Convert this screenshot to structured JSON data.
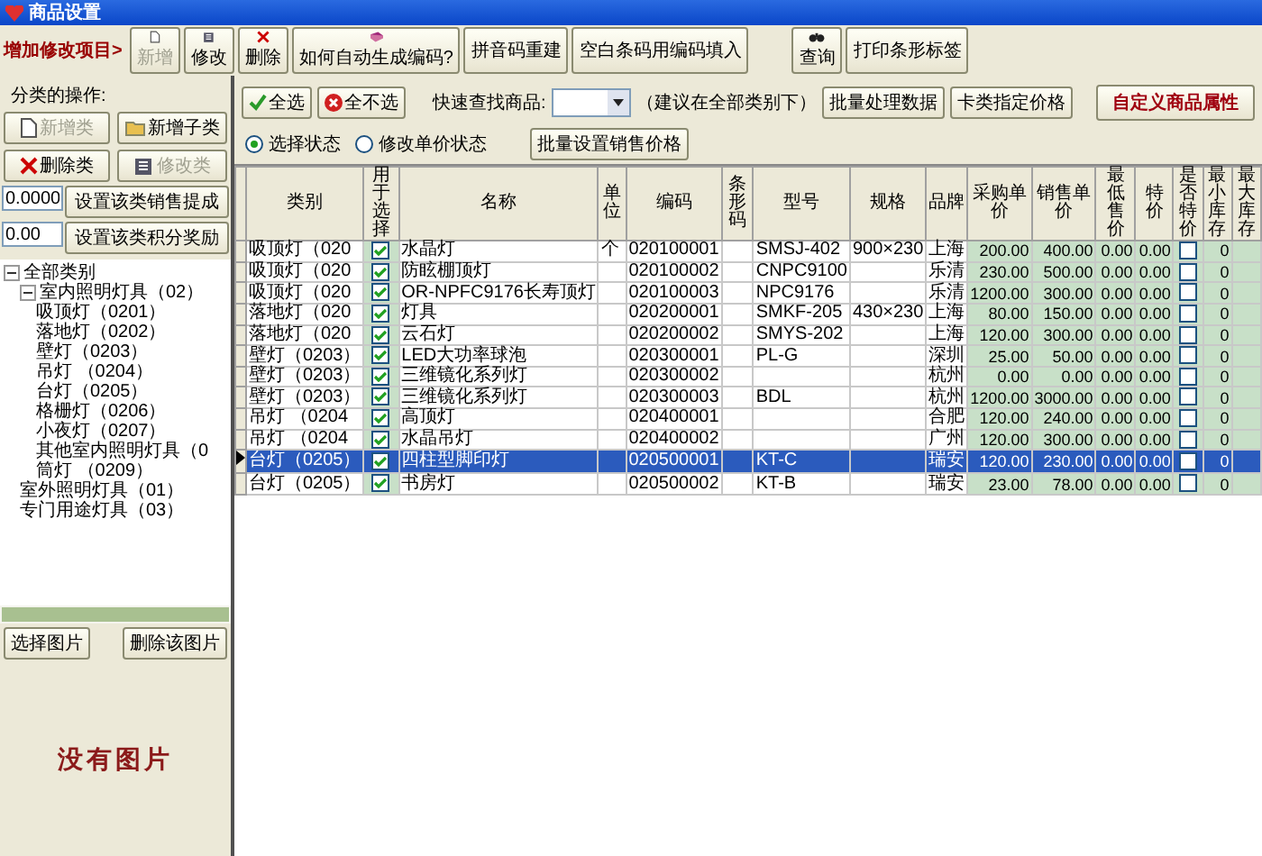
{
  "window": {
    "title": "商品设置"
  },
  "toolbar": {
    "label": "增加修改项目>",
    "buttons": [
      {
        "label": "新增",
        "kind": "page",
        "disabled": true
      },
      {
        "label": "修改",
        "kind": "edit",
        "disabled": false
      },
      {
        "label": "删除",
        "kind": "cross",
        "disabled": false
      },
      {
        "label": "如何自动生成编码?",
        "kind": "book",
        "disabled": false
      },
      {
        "label": "拼音码重建",
        "disabled": false
      },
      {
        "label": "空白条码用编码填入",
        "disabled": false
      }
    ],
    "right_buttons": [
      {
        "label": "查询",
        "kind": "binoculars",
        "disabled": false
      },
      {
        "label": "打印条形标签",
        "disabled": false
      }
    ]
  },
  "category_ops": {
    "label": "分类的操作:",
    "buttons": [
      {
        "label": "新增类",
        "kind": "page",
        "disabled": true
      },
      {
        "label": "新增子类",
        "kind": "folder",
        "disabled": false
      },
      {
        "label": "删除类",
        "kind": "cross",
        "disabled": false
      },
      {
        "label": "修改类",
        "kind": "edit",
        "disabled": true
      }
    ],
    "settings": [
      {
        "value": "0.0000",
        "button": "设置该类销售提成"
      },
      {
        "value": "0.00",
        "button": "设置该类积分奖励"
      }
    ]
  },
  "tree": {
    "label": "全部类别",
    "expanded": true,
    "children": [
      {
        "label": "室内照明灯具（02）",
        "expanded": true,
        "children": [
          {
            "label": "吸顶灯（0201）"
          },
          {
            "label": "落地灯（0202）"
          },
          {
            "label": "壁灯（0203）"
          },
          {
            "label": "吊灯 （0204）"
          },
          {
            "label": "台灯（0205）"
          },
          {
            "label": "格栅灯（0206）"
          },
          {
            "label": "小夜灯（0207）"
          },
          {
            "label": "其他室内照明灯具（0"
          },
          {
            "label": "筒灯 （0209）"
          }
        ]
      },
      {
        "label": "室外照明灯具（01）"
      },
      {
        "label": "专门用途灯具（03）"
      }
    ]
  },
  "image": {
    "buttons": [
      "选择图片",
      "删除该图片"
    ],
    "empty_text": "没有图片"
  },
  "select_buttons": [
    {
      "label": "全选",
      "kind": "tick"
    },
    {
      "label": "全不选",
      "kind": "stop"
    }
  ],
  "quick_search": {
    "label": "快速查找商品:",
    "hint": "（建议在全部类别下）"
  },
  "action_buttons": [
    {
      "label": "批量处理数据",
      "emphasis": false
    },
    {
      "label": "卡类指定价格",
      "emphasis": false
    },
    {
      "label": "自定义商品属性",
      "emphasis": true
    }
  ],
  "modes": [
    {
      "label": "选择状态",
      "selected": true
    },
    {
      "label": "修改单价状态",
      "selected": false
    }
  ],
  "batch_price_button": "批量设置销售价格",
  "table": {
    "columns": [
      "类别",
      "用于选择",
      "名称",
      "单位",
      "编码",
      "条形码",
      "型号",
      "规格",
      "品牌",
      "采购单价",
      "销售单价",
      "最低售价",
      "特价",
      "是否特价",
      "最小库存",
      "最大库存"
    ],
    "rows": [
      {
        "selected": false,
        "category": "吸顶灯（020",
        "use": true,
        "name": "水晶灯",
        "unit": "个",
        "code": "020100001",
        "barcode": "",
        "model": "SMSJ-402",
        "spec": "900×230",
        "brand": "上海",
        "purchase": "200.00",
        "sale": "400.00",
        "min_price": "0.00",
        "special_price": "0.00",
        "special": false,
        "min_stock": "0"
      },
      {
        "selected": false,
        "category": "吸顶灯（020",
        "use": true,
        "name": "防眩棚顶灯",
        "unit": "",
        "code": "020100002",
        "barcode": "",
        "model": "CNPC9100",
        "spec": "",
        "brand": "乐清",
        "purchase": "230.00",
        "sale": "500.00",
        "min_price": "0.00",
        "special_price": "0.00",
        "special": false,
        "min_stock": "0"
      },
      {
        "selected": false,
        "category": "吸顶灯（020",
        "use": true,
        "name": "OR-NPFC9176长寿顶灯",
        "unit": "",
        "code": "020100003",
        "barcode": "",
        "model": "NPC9176",
        "spec": "",
        "brand": "乐清",
        "purchase": "1200.00",
        "sale": "300.00",
        "min_price": "0.00",
        "special_price": "0.00",
        "special": false,
        "min_stock": "0"
      },
      {
        "selected": false,
        "category": "落地灯（020",
        "use": true,
        "name": "灯具",
        "unit": "",
        "code": "020200001",
        "barcode": "",
        "model": "SMKF-205",
        "spec": "430×230",
        "brand": "上海",
        "purchase": "80.00",
        "sale": "150.00",
        "min_price": "0.00",
        "special_price": "0.00",
        "special": false,
        "min_stock": "0"
      },
      {
        "selected": false,
        "category": "落地灯（020",
        "use": true,
        "name": "云石灯",
        "unit": "",
        "code": "020200002",
        "barcode": "",
        "model": "SMYS-202",
        "spec": "",
        "brand": "上海",
        "purchase": "120.00",
        "sale": "300.00",
        "min_price": "0.00",
        "special_price": "0.00",
        "special": false,
        "min_stock": "0"
      },
      {
        "selected": false,
        "category": "壁灯（0203）",
        "use": true,
        "name": "LED大功率球泡",
        "unit": "",
        "code": "020300001",
        "barcode": "",
        "model": "PL-G",
        "spec": "",
        "brand": "深圳",
        "purchase": "25.00",
        "sale": "50.00",
        "min_price": "0.00",
        "special_price": "0.00",
        "special": false,
        "min_stock": "0"
      },
      {
        "selected": false,
        "category": "壁灯（0203）",
        "use": true,
        "name": "三维镜化系列灯",
        "unit": "",
        "code": "020300002",
        "barcode": "",
        "model": "",
        "spec": "",
        "brand": "杭州",
        "purchase": "0.00",
        "sale": "0.00",
        "min_price": "0.00",
        "special_price": "0.00",
        "special": false,
        "min_stock": "0"
      },
      {
        "selected": false,
        "category": "壁灯（0203）",
        "use": true,
        "name": "三维镜化系列灯",
        "unit": "",
        "code": "020300003",
        "barcode": "",
        "model": "BDL",
        "spec": "",
        "brand": "杭州",
        "purchase": "1200.00",
        "sale": "3000.00",
        "min_price": "0.00",
        "special_price": "0.00",
        "special": false,
        "min_stock": "0"
      },
      {
        "selected": false,
        "category": "吊灯 （0204",
        "use": true,
        "name": "高顶灯",
        "unit": "",
        "code": "020400001",
        "barcode": "",
        "model": "",
        "spec": "",
        "brand": "合肥",
        "purchase": "120.00",
        "sale": "240.00",
        "min_price": "0.00",
        "special_price": "0.00",
        "special": false,
        "min_stock": "0"
      },
      {
        "selected": false,
        "category": "吊灯 （0204",
        "use": true,
        "name": "水晶吊灯",
        "unit": "",
        "code": "020400002",
        "barcode": "",
        "model": "",
        "spec": "",
        "brand": "广州",
        "purchase": "120.00",
        "sale": "300.00",
        "min_price": "0.00",
        "special_price": "0.00",
        "special": false,
        "min_stock": "0"
      },
      {
        "selected": true,
        "category": "台灯（0205）",
        "use": true,
        "name": "四柱型脚印灯",
        "unit": "",
        "code": "020500001",
        "barcode": "",
        "model": "KT-C",
        "spec": "",
        "brand": "瑞安",
        "purchase": "120.00",
        "sale": "230.00",
        "min_price": "0.00",
        "special_price": "0.00",
        "special": false,
        "min_stock": "0"
      },
      {
        "selected": false,
        "category": "台灯（0205）",
        "use": true,
        "name": "书房灯",
        "unit": "",
        "code": "020500002",
        "barcode": "",
        "model": "KT-B",
        "spec": "",
        "brand": "瑞安",
        "purchase": "23.00",
        "sale": "78.00",
        "min_price": "0.00",
        "special_price": "0.00",
        "special": false,
        "min_stock": "0"
      }
    ]
  }
}
